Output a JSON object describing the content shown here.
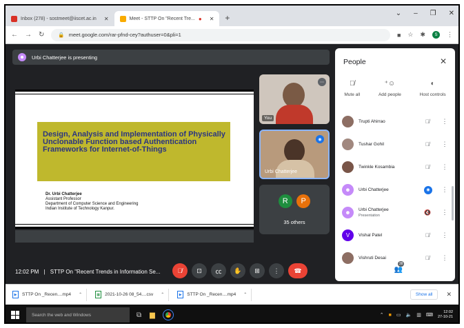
{
  "browser": {
    "tabs": [
      {
        "label": "Inbox (278) - sostmeet@iiscet.ac.in",
        "favicon_color": "#d93025",
        "active": false
      },
      {
        "label": "Meet - STTP On \"Recent Tre...",
        "favicon_color": "#f9ab00",
        "active": true
      }
    ],
    "new_tab": "+",
    "url": "meet.google.com/rar-pfnd-cey?authuser=0&pli=1",
    "profile_initial": "S"
  },
  "meet": {
    "presenting_text": "Urbi Chatterjee is presenting",
    "slide": {
      "title": "Design, Analysis and Implementation of Physically Unclonable Function based Authentication Frameworks for Internet-of-Things",
      "author_name": "Dr. Urbi Chatterjee",
      "author_role": "Assistant Professor",
      "author_dept": "Department of Computer Science and Engineering",
      "author_inst": "Indian Institute of Technology Kanpur."
    },
    "tiles": {
      "you_label": "You",
      "speaker_label": "Urbi Chatterjee",
      "others_initials": [
        "R",
        "P"
      ],
      "others_colors": [
        "#1e8e3e",
        "#e8710a"
      ],
      "others_label": "35 others"
    },
    "controls": {
      "time": "12:02 PM",
      "separator": "|",
      "meeting_title": "STTP On \"Recent Trends in Information Se...",
      "people_count": "38"
    }
  },
  "people": {
    "title": "People",
    "actions": [
      {
        "label": "Mute all",
        "icon": "mic-off-icon"
      },
      {
        "label": "Add people",
        "icon": "add-person-icon"
      },
      {
        "label": "Host controls",
        "icon": "toggle-icon"
      }
    ],
    "list": [
      {
        "name": "Trupti Ahirrao",
        "sub": "",
        "color": "#8d6e63",
        "mic": "muted"
      },
      {
        "name": "Tushar Gohil",
        "sub": "",
        "color": "#a1887f",
        "mic": "muted"
      },
      {
        "name": "Twinkle Kosambia",
        "sub": "",
        "color": "#795548",
        "mic": "muted"
      },
      {
        "name": "Urbi Chatterjee",
        "sub": "",
        "color": "#c58af9",
        "mic": "active"
      },
      {
        "name": "Urbi Chatterjee",
        "sub": "Presentation",
        "color": "#c58af9",
        "mic": "presenting"
      },
      {
        "name": "Vishal Patel",
        "sub": "",
        "color": "#6200ea",
        "initial": "V",
        "mic": "muted"
      },
      {
        "name": "Vishruti Desai",
        "sub": "",
        "color": "#8d6e63",
        "mic": "muted"
      }
    ]
  },
  "downloads": {
    "items": [
      {
        "name": "STTP On _Recen....mp4",
        "type": "video"
      },
      {
        "name": "2021-10-26 08_54....csv",
        "type": "csv"
      },
      {
        "name": "STTP On _Recen....mp4",
        "type": "video"
      }
    ],
    "show_all": "Show all"
  },
  "taskbar": {
    "search_placeholder": "Search the web and Windows",
    "time": "12:02",
    "date": "27-10-21"
  }
}
